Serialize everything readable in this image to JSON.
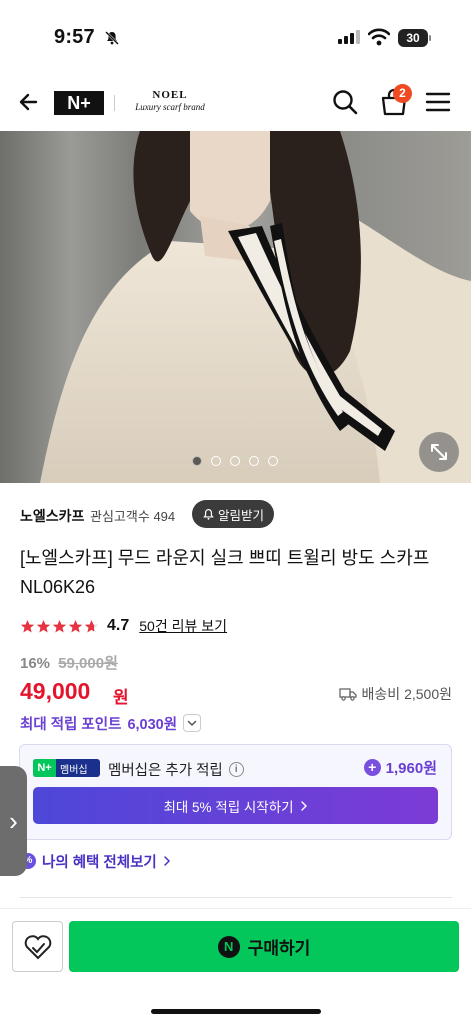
{
  "status_bar": {
    "time": "9:57",
    "battery": "30"
  },
  "header": {
    "logo_text": "N+",
    "brand_line1": "NOEL",
    "brand_line2": "Luxury scarf brand",
    "cart_count": "2"
  },
  "gallery": {
    "dot_count": 5,
    "active_index": 0
  },
  "store": {
    "name": "노엘스카프",
    "interest_label": "관심고객수",
    "interest_count": "494",
    "notify_label": "알림받기"
  },
  "product": {
    "title": "[노엘스카프] 무드 라운지 실크 쁘띠 트윌리 방도 스카프 NL06K26",
    "rating": "4.7",
    "rating_value": 4.7,
    "review_link": "50건 리뷰 보기",
    "discount_pct": "16%",
    "original_price": "59,000원",
    "price": "49,000",
    "price_unit": "원",
    "shipping": "배송비 2,500원",
    "points_label": "최대 적립 포인트",
    "points_value": "6,030원"
  },
  "membership": {
    "tag_n": "N+",
    "tag_label": "멤버십",
    "text": "멤버십은 추가 적립",
    "info": "i",
    "points": "1,960원",
    "cta": "최대 5% 적립 시작하기"
  },
  "benefits": {
    "label": "나의 혜택 전체보기",
    "icon": "%"
  },
  "bottom": {
    "buy_label": "구매하기",
    "n_icon": "N"
  },
  "side_tab": {
    "glyph": "›"
  },
  "colors": {
    "price_red": "#e4142d",
    "points_purple": "#6a3fd1",
    "naver_green": "#03c75a",
    "badge_orange": "#f04a23"
  }
}
